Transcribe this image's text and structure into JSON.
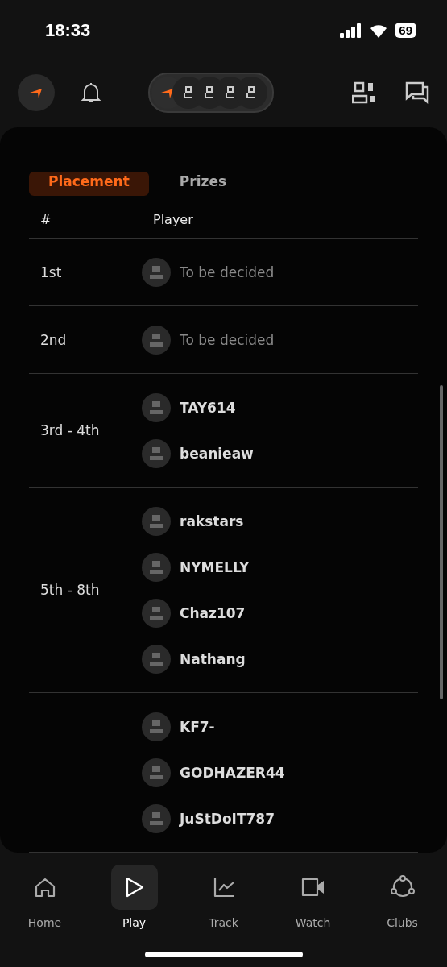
{
  "status_bar": {
    "time": "18:33",
    "battery": "69"
  },
  "tabs": [
    {
      "label": "Placement",
      "selected": true
    },
    {
      "label": "Prizes",
      "selected": false
    }
  ],
  "table": {
    "columns": [
      "#",
      "Player"
    ],
    "groups": [
      {
        "placement": "1st",
        "players": [
          {
            "name": "To be decided",
            "kind": "placeholder"
          }
        ]
      },
      {
        "placement": "2nd",
        "players": [
          {
            "name": "To be decided",
            "kind": "placeholder"
          }
        ]
      },
      {
        "placement": "3rd - 4th",
        "players": [
          {
            "name": "TAY614",
            "kind": "player"
          },
          {
            "name": "beanieaw",
            "kind": "player"
          }
        ]
      },
      {
        "placement": "5th - 8th",
        "players": [
          {
            "name": "rakstars",
            "kind": "player"
          },
          {
            "name": "NYMELLY",
            "kind": "player"
          },
          {
            "name": "Chaz107",
            "kind": "player"
          },
          {
            "name": "Nathang",
            "kind": "player"
          }
        ]
      },
      {
        "players": [
          {
            "name": "KF7-",
            "kind": "player"
          },
          {
            "name": "GODHAZER44",
            "kind": "player"
          },
          {
            "name": "JuStDoIT787",
            "kind": "player"
          }
        ]
      }
    ]
  },
  "nav": [
    {
      "label": "Home",
      "kind": "home",
      "selected": false
    },
    {
      "label": "Play",
      "kind": "play",
      "selected": true
    },
    {
      "label": "Track",
      "kind": "track",
      "selected": false
    },
    {
      "label": "Watch",
      "kind": "watch",
      "selected": false
    },
    {
      "label": "Clubs",
      "kind": "clubs",
      "selected": false
    }
  ]
}
